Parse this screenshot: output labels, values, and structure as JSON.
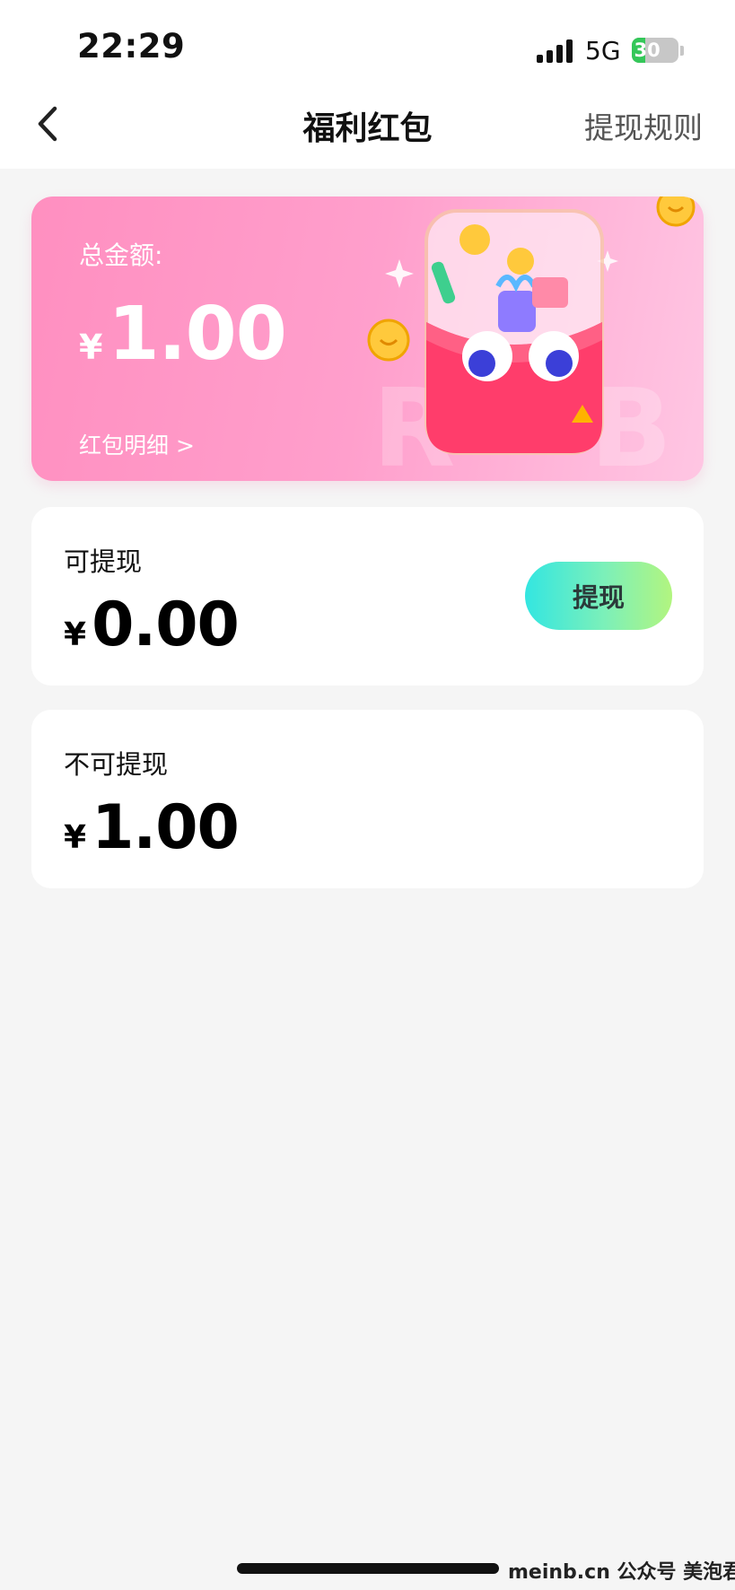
{
  "status_bar": {
    "time": "22:29",
    "network": "5G",
    "battery": "30",
    "battery_level": 0.3
  },
  "nav": {
    "title": "福利红包",
    "rules_label": "提现规则"
  },
  "total_card": {
    "label": "总金额:",
    "currency": "¥",
    "amount": "1.00",
    "detail_link": "红包明细 >",
    "decor_letters": "RB"
  },
  "withdrawable": {
    "label": "可提现",
    "currency": "¥",
    "amount": "0.00",
    "button_label": "提现"
  },
  "non_withdrawable": {
    "label": "不可提现",
    "currency": "¥",
    "amount": "1.00"
  },
  "watermark": "meinb.cn  公众号 美泡君",
  "colors": {
    "card_gradient_start": "#ff8fc0",
    "card_gradient_end": "#ffc6e3",
    "button_gradient_start": "#33e6e1",
    "button_gradient_end": "#b2f57f",
    "background": "#f5f5f5"
  }
}
